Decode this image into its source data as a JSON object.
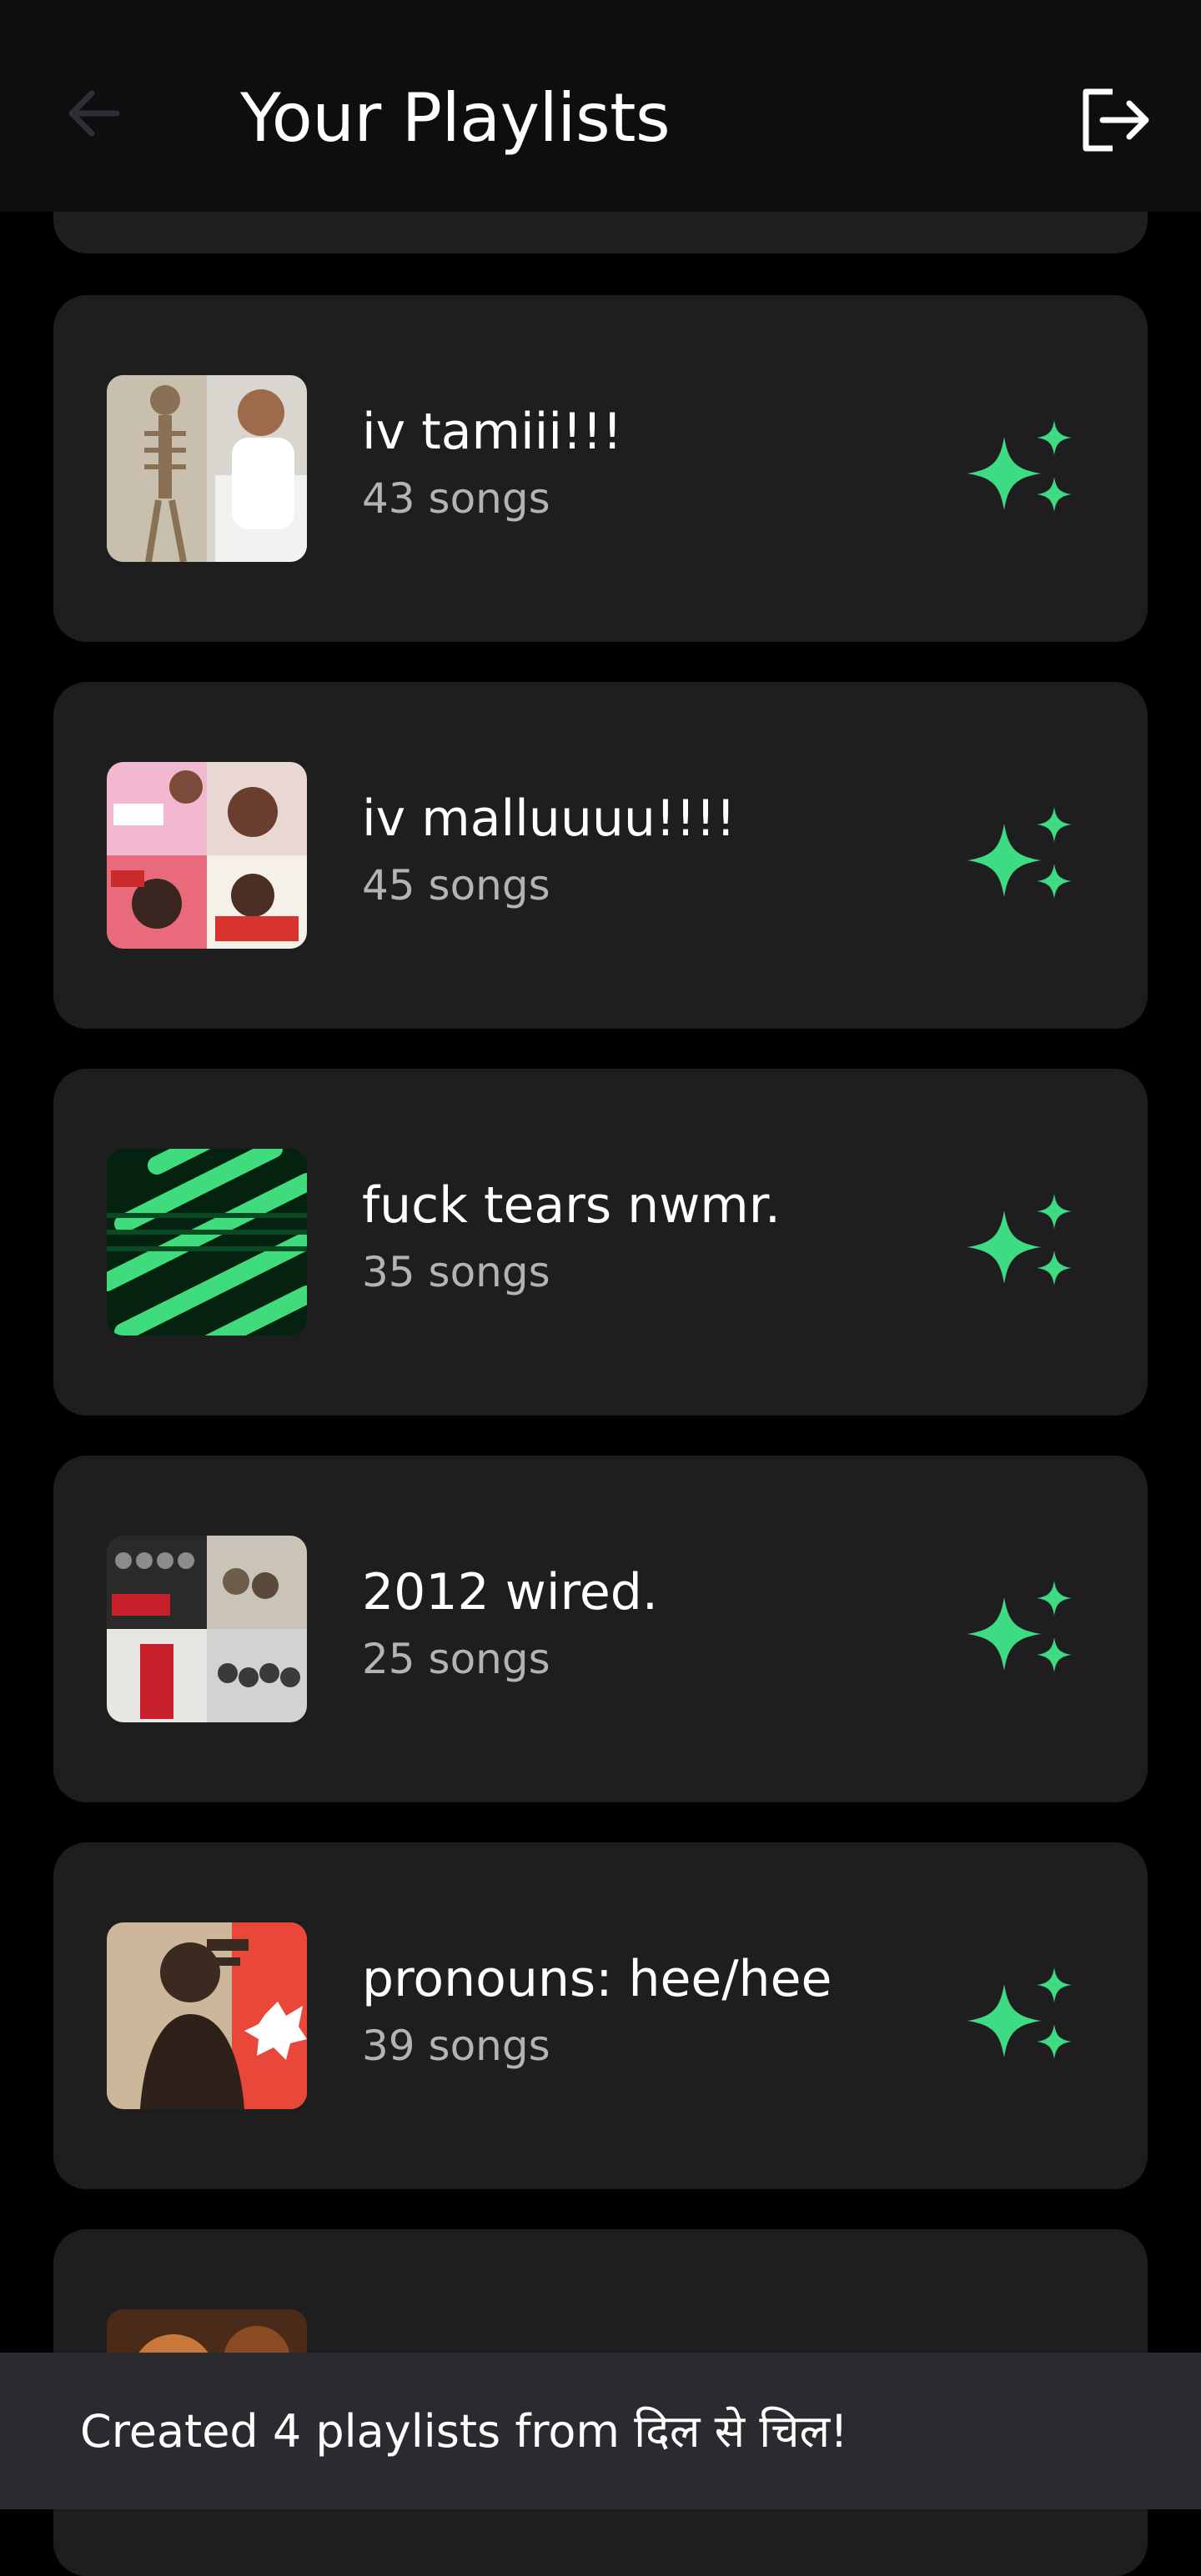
{
  "header": {
    "title": "Your Playlists",
    "back_icon": "arrow-left-icon",
    "logout_icon": "logout-icon"
  },
  "playlists": [
    {
      "name": "",
      "songs": ""
    },
    {
      "name": "iv tamiii!!!",
      "songs": "43 songs"
    },
    {
      "name": "iv malluuuu!!!!",
      "songs": "45 songs"
    },
    {
      "name": "fuck tears nwmr.",
      "songs": "35 songs"
    },
    {
      "name": "2012 wired.",
      "songs": "25 songs"
    },
    {
      "name": "pronouns: hee/hee",
      "songs": "39 songs"
    },
    {
      "name": "",
      "songs": ""
    }
  ],
  "action_icon": "sparkle-icon",
  "snackbar": {
    "message": "Created 4 playlists from दिल से चिल!"
  },
  "colors": {
    "accent": "#3ddc84",
    "card_bg": "#1e1e1f",
    "app_bar_bg": "#0e0e11",
    "snackbar_bg": "#2b2b2f",
    "subtitle": "#b3b3b3"
  }
}
